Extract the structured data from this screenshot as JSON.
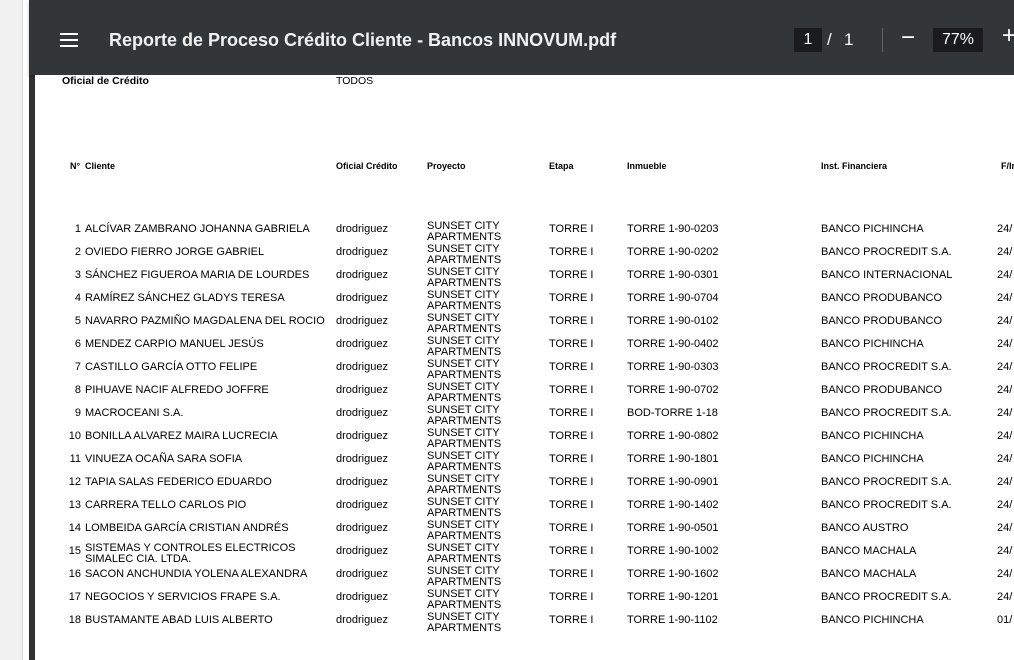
{
  "toolbar": {
    "title": "Reporte de Proceso Crédito Cliente - Bancos INNOVUM.pdf",
    "current_page": "1",
    "page_separator": "/",
    "total_pages": "1",
    "zoom_minus": "−",
    "zoom": "77%",
    "zoom_plus": "+"
  },
  "report": {
    "officer_label": "Oficial de Crédito",
    "officer_value": "TODOS",
    "headers": {
      "num": "N°",
      "client": "Cliente",
      "officer": "Oficial Crédito",
      "project": "Proyecto",
      "stage": "Etapa",
      "property": "Inmueble",
      "bank": "Inst. Financiera",
      "date": "F/In"
    },
    "rows": [
      {
        "num": "1",
        "client": "ALCÍVAR ZAMBRANO JOHANNA GABRIELA",
        "officer": "drodriguez",
        "project1": "SUNSET CITY",
        "project2": "APARTMENTS",
        "stage": "TORRE I",
        "property": "TORRE 1-90-0203",
        "bank": "BANCO PICHINCHA",
        "date": "24/"
      },
      {
        "num": "2",
        "client": "OVIEDO FIERRO JORGE GABRIEL",
        "officer": "drodriguez",
        "project1": "SUNSET CITY",
        "project2": "APARTMENTS",
        "stage": "TORRE I",
        "property": "TORRE 1-90-0202",
        "bank": "BANCO PROCREDIT S.A.",
        "date": "24/"
      },
      {
        "num": "3",
        "client": "SÁNCHEZ FIGUEROA MARIA DE LOURDES",
        "officer": "drodriguez",
        "project1": "SUNSET CITY",
        "project2": "APARTMENTS",
        "stage": "TORRE I",
        "property": "TORRE 1-90-0301",
        "bank": "BANCO INTERNACIONAL",
        "date": "24/"
      },
      {
        "num": "4",
        "client": "RAMÍREZ SÁNCHEZ GLADYS TERESA",
        "officer": "drodriguez",
        "project1": "SUNSET CITY",
        "project2": "APARTMENTS",
        "stage": "TORRE I",
        "property": "TORRE 1-90-0704",
        "bank": "BANCO PRODUBANCO",
        "date": "24/"
      },
      {
        "num": "5",
        "client": "NAVARRO PAZMIÑO MAGDALENA DEL ROCIO",
        "officer": "drodriguez",
        "project1": "SUNSET CITY",
        "project2": "APARTMENTS",
        "stage": "TORRE I",
        "property": "TORRE 1-90-0102",
        "bank": "BANCO PRODUBANCO",
        "date": "24/"
      },
      {
        "num": "6",
        "client": "MENDEZ CARPIO MANUEL JESÚS",
        "officer": "drodriguez",
        "project1": "SUNSET CITY",
        "project2": "APARTMENTS",
        "stage": "TORRE I",
        "property": "TORRE 1-90-0402",
        "bank": "BANCO PICHINCHA",
        "date": "24/"
      },
      {
        "num": "7",
        "client": "CASTILLO GARCÍA OTTO FELIPE",
        "officer": "drodriguez",
        "project1": "SUNSET CITY",
        "project2": "APARTMENTS",
        "stage": "TORRE I",
        "property": "TORRE 1-90-0303",
        "bank": "BANCO PROCREDIT S.A.",
        "date": "24/"
      },
      {
        "num": "8",
        "client": "PIHUAVE NACIF ALFREDO JOFFRE",
        "officer": "drodriguez",
        "project1": "SUNSET CITY",
        "project2": "APARTMENTS",
        "stage": "TORRE I",
        "property": "TORRE 1-90-0702",
        "bank": "BANCO PRODUBANCO",
        "date": "24/"
      },
      {
        "num": "9",
        "client": "MACROCEANI S.A.",
        "officer": "drodriguez",
        "project1": "SUNSET CITY",
        "project2": "APARTMENTS",
        "stage": "TORRE I",
        "property": "BOD-TORRE 1-18",
        "bank": "BANCO PROCREDIT S.A.",
        "date": "24/"
      },
      {
        "num": "10",
        "client": "BONILLA ALVAREZ MAIRA LUCRECIA",
        "officer": "drodriguez",
        "project1": "SUNSET CITY",
        "project2": "APARTMENTS",
        "stage": "TORRE I",
        "property": "TORRE 1-90-0802",
        "bank": "BANCO PICHINCHA",
        "date": "24/"
      },
      {
        "num": "11",
        "client": "VINUEZA OCAÑA SARA SOFIA",
        "officer": "drodriguez",
        "project1": "SUNSET CITY",
        "project2": "APARTMENTS",
        "stage": "TORRE I",
        "property": "TORRE 1-90-1801",
        "bank": "BANCO PICHINCHA",
        "date": "24/"
      },
      {
        "num": "12",
        "client": "TAPIA SALAS FEDERICO EDUARDO",
        "officer": "drodriguez",
        "project1": "SUNSET CITY",
        "project2": "APARTMENTS",
        "stage": "TORRE I",
        "property": "TORRE 1-90-0901",
        "bank": "BANCO PROCREDIT S.A.",
        "date": "24/"
      },
      {
        "num": "13",
        "client": "CARRERA TELLO CARLOS PIO",
        "officer": "drodriguez",
        "project1": "SUNSET CITY",
        "project2": "APARTMENTS",
        "stage": "TORRE I",
        "property": "TORRE 1-90-1402",
        "bank": "BANCO PROCREDIT S.A.",
        "date": "24/"
      },
      {
        "num": "14",
        "client": "LOMBEIDA GARCÍA CRISTIAN ANDRÉS",
        "officer": "drodriguez",
        "project1": "SUNSET CITY",
        "project2": "APARTMENTS",
        "stage": "TORRE I",
        "property": "TORRE 1-90-0501",
        "bank": "BANCO AUSTRO",
        "date": "24/"
      },
      {
        "num": "15",
        "client": "SISTEMAS Y CONTROLES ELECTRICOS SIMALEC CIA. LTDA.",
        "officer": "drodriguez",
        "project1": "SUNSET CITY",
        "project2": "APARTMENTS",
        "stage": "TORRE I",
        "property": "TORRE 1-90-1002",
        "bank": "BANCO MACHALA",
        "date": "24/"
      },
      {
        "num": "16",
        "client": "SACON ANCHUNDIA YOLENA ALEXANDRA",
        "officer": "drodriguez",
        "project1": "SUNSET CITY",
        "project2": "APARTMENTS",
        "stage": "TORRE I",
        "property": "TORRE 1-90-1602",
        "bank": "BANCO MACHALA",
        "date": "24/"
      },
      {
        "num": "17",
        "client": "NEGOCIOS Y SERVICIOS FRAPE S.A.",
        "officer": "drodriguez",
        "project1": "SUNSET CITY",
        "project2": "APARTMENTS",
        "stage": "TORRE I",
        "property": "TORRE 1-90-1201",
        "bank": "BANCO PROCREDIT S.A.",
        "date": "24/"
      },
      {
        "num": "18",
        "client": "BUSTAMANTE ABAD LUIS ALBERTO",
        "officer": "drodriguez",
        "project1": "SUNSET CITY",
        "project2": "APARTMENTS",
        "stage": "TORRE I",
        "property": "TORRE 1-90-1102",
        "bank": "BANCO PICHINCHA",
        "date": "01/"
      }
    ]
  }
}
